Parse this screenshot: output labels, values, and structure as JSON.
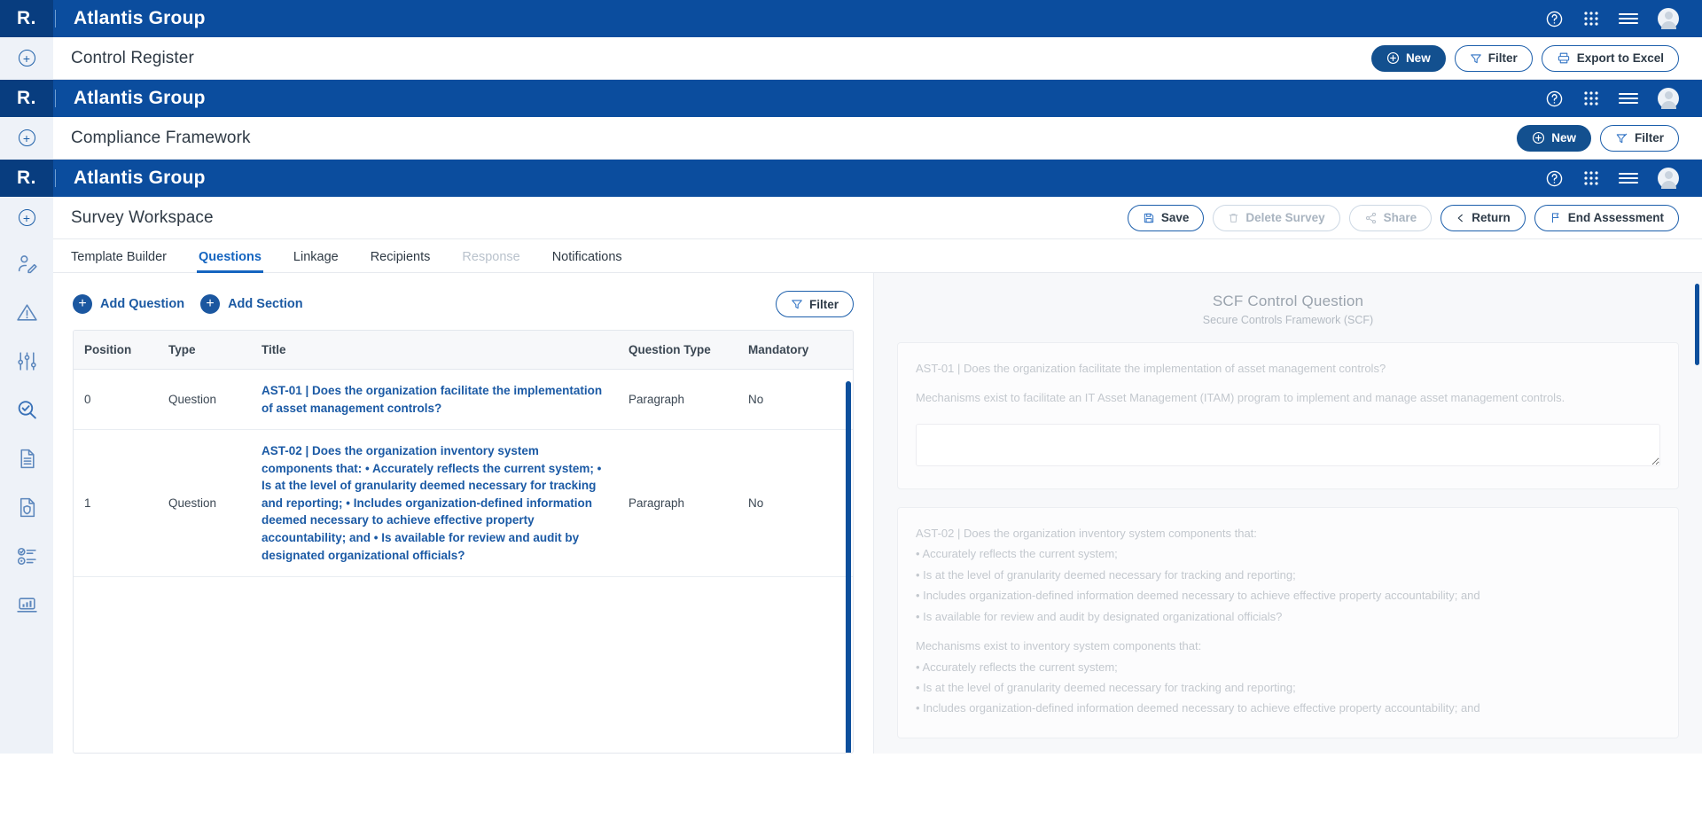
{
  "brand": {
    "logo_text": "R.",
    "logo_dot": "",
    "org_name": "Atlantis Group"
  },
  "header_icons": {
    "help": "help-circle-icon",
    "apps": "apps-grid-icon",
    "menu": "hamburger-menu-icon",
    "avatar": "user-avatar-icon"
  },
  "screens": {
    "control_register": {
      "title": "Control Register",
      "actions": [
        {
          "label": "New",
          "icon": "plus-circle-icon",
          "style": "primary",
          "disabled": false
        },
        {
          "label": "Filter",
          "icon": "funnel-icon",
          "style": "outline",
          "disabled": false
        },
        {
          "label": "Export to Excel",
          "icon": "export-icon",
          "style": "outline",
          "disabled": false
        }
      ]
    },
    "compliance_framework": {
      "title": "Compliance Framework",
      "actions": [
        {
          "label": "New",
          "icon": "plus-circle-icon",
          "style": "primary",
          "disabled": false
        },
        {
          "label": "Filter",
          "icon": "funnel-check-icon",
          "style": "outline",
          "disabled": false
        }
      ]
    },
    "survey_workspace": {
      "title": "Survey Workspace",
      "actions": [
        {
          "label": "Save",
          "icon": "floppy-disk-icon",
          "style": "outline",
          "disabled": false
        },
        {
          "label": "Delete Survey",
          "icon": "trash-icon",
          "style": "outline",
          "disabled": true
        },
        {
          "label": "Share",
          "icon": "share-nodes-icon",
          "style": "outline",
          "disabled": true
        },
        {
          "label": "Return",
          "icon": "chevron-left-icon",
          "style": "outline",
          "disabled": false
        },
        {
          "label": "End Assessment",
          "icon": "flag-icon",
          "style": "outline",
          "disabled": false
        }
      ],
      "tabs": [
        {
          "label": "Template Builder",
          "active": false,
          "disabled": false
        },
        {
          "label": "Questions",
          "active": true,
          "disabled": false
        },
        {
          "label": "Linkage",
          "active": false,
          "disabled": false
        },
        {
          "label": "Recipients",
          "active": false,
          "disabled": false
        },
        {
          "label": "Response",
          "active": false,
          "disabled": true
        },
        {
          "label": "Notifications",
          "active": false,
          "disabled": false
        }
      ],
      "toolbar": {
        "add_question": "Add Question",
        "add_section": "Add Section",
        "filter": "Filter"
      },
      "table": {
        "columns": [
          "Position",
          "Type",
          "Title",
          "Question Type",
          "Mandatory"
        ],
        "rows": [
          {
            "position": "0",
            "type": "Question",
            "title": "AST-01 | Does the organization facilitate the implementation of asset management controls?",
            "question_type": "Paragraph",
            "mandatory": "No"
          },
          {
            "position": "1",
            "type": "Question",
            "title": "AST-02 | Does the organization inventory system components that: • Accurately reflects the current system; • Is at the level of granularity deemed necessary for tracking and reporting; • Includes organization-defined information deemed necessary to achieve effective property accountability; and • Is available for review and audit by designated organizational officials?",
            "question_type": "Paragraph",
            "mandatory": "No"
          }
        ]
      },
      "detail_panel": {
        "title": "SCF Control Question",
        "subtitle": "Secure Controls Framework (SCF)",
        "cards": [
          {
            "question": "AST-01 | Does the organization facilitate the implementation of asset management controls?",
            "body": "Mechanisms exist to facilitate an IT Asset Management (ITAM) program to implement and manage asset management controls.",
            "answer_value": "",
            "answer_placeholder": ""
          },
          {
            "question": "AST-02 | Does the organization inventory system components that:",
            "question_bullets": [
              "• Accurately reflects the current system;",
              "• Is at the level of granularity deemed necessary for tracking and reporting;",
              "• Includes organization-defined information deemed necessary to achieve effective property accountability; and",
              "• Is available for review and audit by designated organizational officials?"
            ],
            "body": "Mechanisms exist to inventory system components that:",
            "body_bullets": [
              "• Accurately reflects the current system;",
              "• Is at the level of granularity deemed necessary for tracking and reporting;",
              "• Includes organization-defined information deemed necessary to achieve effective property accountability; and"
            ]
          }
        ]
      },
      "rail_icons": [
        "user-edit-icon",
        "warning-triangle-icon",
        "sliders-settings-icon",
        "search-check-icon",
        "document-lines-icon",
        "document-shield-icon",
        "checklist-icon",
        "laptop-chart-icon"
      ]
    }
  },
  "colors": {
    "brand_blue": "#0b4d9e",
    "brand_blue_dark": "#083d7f",
    "accent_blue": "#1565c0",
    "rail_bg": "#eef2f8",
    "panel_bg": "#f7f8fa",
    "scrollbar": "#0d4f9c",
    "muted_text": "#c3c8ce"
  }
}
